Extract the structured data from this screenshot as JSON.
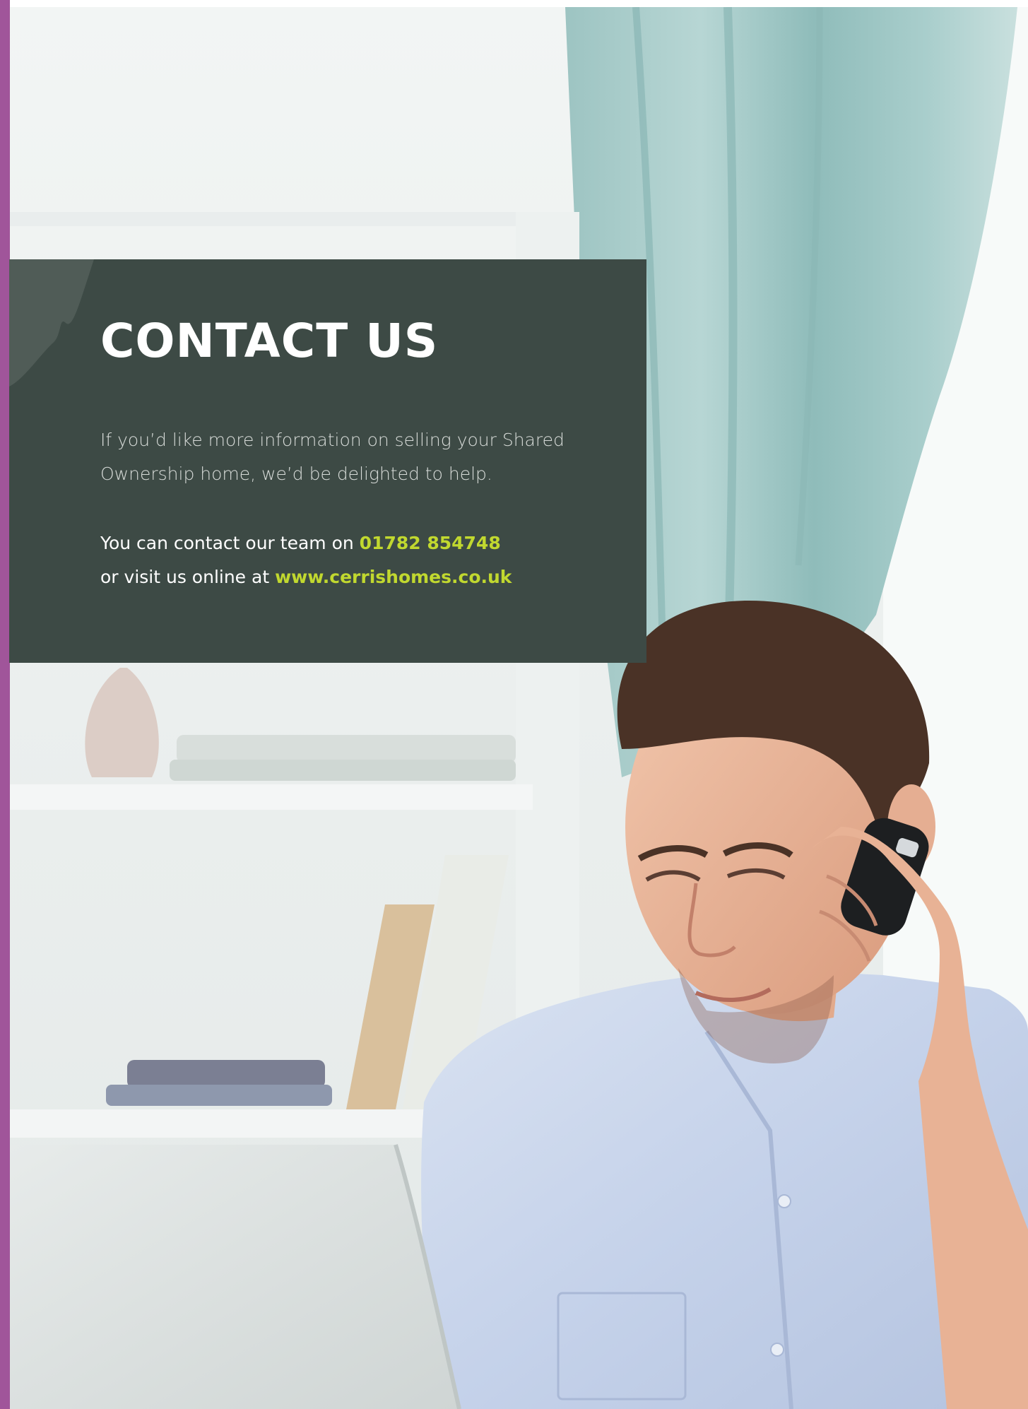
{
  "colors": {
    "accent_purple": "#a0559a",
    "panel_background": "#3d4a45",
    "highlight_green": "#c1d82f",
    "text_white": "#ffffff"
  },
  "photo": {
    "description_icon": "man-on-phone-photo"
  },
  "contact": {
    "heading": "CONTACT US",
    "intro_line_1": "If you’d like more information on selling your Shared",
    "intro_line_2": "Ownership home, we’d be delighted to help.",
    "phone_prefix": "You can contact our team on",
    "phone_number": "01782 854748",
    "web_prefix": "or visit us online at",
    "website": "www.cerrishomes.co.uk"
  }
}
